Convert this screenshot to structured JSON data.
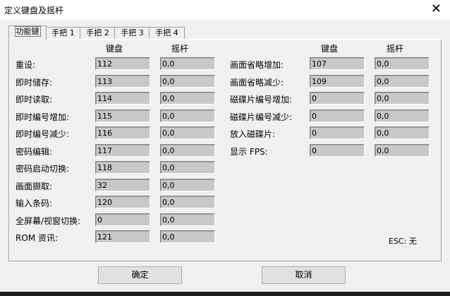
{
  "window": {
    "title": "定义键盘及摇杆",
    "close_symbol": "✕"
  },
  "tabs": [
    "功能键",
    "手把 1",
    "手把 2",
    "手把 3",
    "手把 4"
  ],
  "headers": {
    "keyboard": "键盘",
    "joystick": "摇杆"
  },
  "left_rows": [
    {
      "label": "重设:",
      "key": "112",
      "joy": "0,0"
    },
    {
      "label": "即时储存:",
      "key": "113",
      "joy": "0,0"
    },
    {
      "label": "即时读取:",
      "key": "114",
      "joy": "0,0"
    },
    {
      "label": "即时编号增加:",
      "key": "115",
      "joy": "0,0"
    },
    {
      "label": "即时编号减少:",
      "key": "116",
      "joy": "0,0"
    },
    {
      "label": "密码编辑:",
      "key": "117",
      "joy": "0,0"
    },
    {
      "label": "密码启动切换:",
      "key": "118",
      "joy": "0,0"
    },
    {
      "label": "画面撷取:",
      "key": "32",
      "joy": "0,0"
    },
    {
      "label": "输入条码:",
      "key": "120",
      "joy": "0,0"
    },
    {
      "label": "全屏幕/视窗切换:",
      "key": "0",
      "joy": "0,0"
    },
    {
      "label": "ROM 资讯:",
      "key": "121",
      "joy": "0,0"
    }
  ],
  "right_rows": [
    {
      "label": "画面省略增加:",
      "key": "107",
      "joy": "0,0"
    },
    {
      "label": "画面省略减少:",
      "key": "109",
      "joy": "0,0"
    },
    {
      "label": "磁碟片编号增加:",
      "key": "0",
      "joy": "0,0"
    },
    {
      "label": "磁碟片编号减少:",
      "key": "0",
      "joy": "0,0"
    },
    {
      "label": "放入磁碟片:",
      "key": "0",
      "joy": "0,0"
    },
    {
      "label": "显示 FPS:",
      "key": "0",
      "joy": "0,0"
    }
  ],
  "esc_note": "ESC: 无",
  "buttons": {
    "ok": "确定",
    "cancel": "取消"
  }
}
